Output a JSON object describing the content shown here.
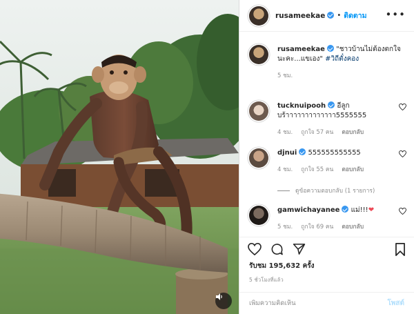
{
  "post": {
    "author": "rusameekae",
    "follow_label": "ติดตาม",
    "more_label": "•••",
    "mute_icon": "speaker-icon"
  },
  "caption": {
    "author": "rusameekae",
    "text": " \"ชาวบ้านไม่ต้องตกใจนะคะ...แขเอง\" ",
    "hashtag": "#วิถีตั๋งคอง",
    "time": "5 ชม."
  },
  "comments": [
    {
      "author": "tucknuipooh",
      "text": " อีลูก บร้าาาาาาาาาาาาา5555555",
      "time": "4 ชม.",
      "likes": "ถูกใจ 57 คน",
      "reply": "ตอบกลับ"
    },
    {
      "author": "djnui",
      "text": " 555555555555",
      "time": "4 ชม.",
      "likes": "ถูกใจ 55 คน",
      "reply": "ตอบกลับ",
      "view_replies": "ดูข้อความตอบกลับ (1 รายการ)"
    },
    {
      "author": "gamwichayanee",
      "text": " แม่!!!",
      "emoji": "❤",
      "time": "5 ชม.",
      "likes": "ถูกใจ 69 คน",
      "reply": "ตอบกลับ"
    }
  ],
  "stats": {
    "views": "รับชม 195,632 ครั้ง",
    "posted": "5 ชั่วโมงที่แล้ว"
  },
  "composer": {
    "placeholder": "เพิ่มความคิดเห็น",
    "post_label": "โพสต์"
  },
  "colors": {
    "link_blue": "#0095f6",
    "verified": "#3897f0",
    "heart_red": "#ed4956",
    "muted_text": "#8e8e8e"
  }
}
